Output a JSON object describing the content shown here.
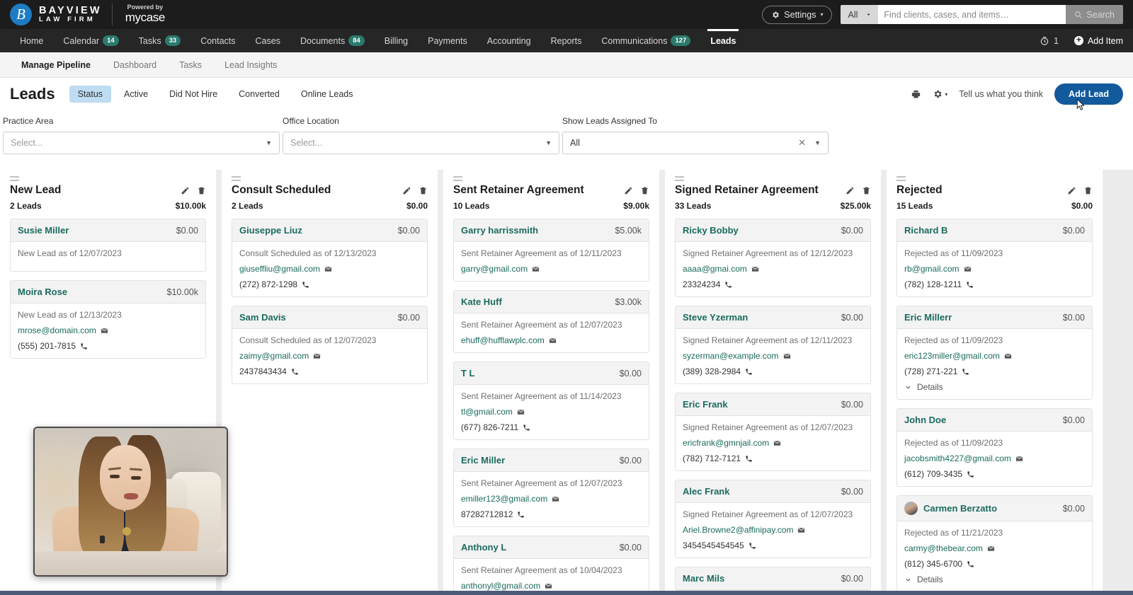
{
  "topbar": {
    "brand_line1": "BAYVIEW",
    "brand_line2": "LAW FIRM",
    "brand_mark": "B",
    "powered_by_top": "Powered by",
    "powered_by_bottom": "mycase",
    "settings_label": "Settings",
    "settings_icon": "gear-icon",
    "search_scope": "All",
    "search_placeholder": "Find clients, cases, and items…",
    "search_value": "",
    "search_button_label": "Search"
  },
  "nav": {
    "items": [
      {
        "label": "Home",
        "badge": "",
        "active": false
      },
      {
        "label": "Calendar",
        "badge": "14",
        "active": false
      },
      {
        "label": "Tasks",
        "badge": "33",
        "active": false
      },
      {
        "label": "Contacts",
        "badge": "",
        "active": false
      },
      {
        "label": "Cases",
        "badge": "",
        "active": false
      },
      {
        "label": "Documents",
        "badge": "84",
        "active": false
      },
      {
        "label": "Billing",
        "badge": "",
        "active": false
      },
      {
        "label": "Payments",
        "badge": "",
        "active": false
      },
      {
        "label": "Accounting",
        "badge": "",
        "active": false
      },
      {
        "label": "Reports",
        "badge": "",
        "active": false
      },
      {
        "label": "Communications",
        "badge": "127",
        "active": false
      },
      {
        "label": "Leads",
        "badge": "",
        "active": true
      }
    ],
    "timer_count": "1",
    "add_item_label": "Add Item"
  },
  "subnav": {
    "items": [
      {
        "label": "Manage Pipeline",
        "active": true
      },
      {
        "label": "Dashboard",
        "active": false
      },
      {
        "label": "Tasks",
        "active": false
      },
      {
        "label": "Lead Insights",
        "active": false
      }
    ]
  },
  "pagehead": {
    "title": "Leads",
    "pills": [
      {
        "label": "Status",
        "active": true
      },
      {
        "label": "Active",
        "active": false
      },
      {
        "label": "Did Not Hire",
        "active": false
      },
      {
        "label": "Converted",
        "active": false
      },
      {
        "label": "Online Leads",
        "active": false
      }
    ],
    "print_icon": "printer-icon",
    "settings_icon": "gear-icon",
    "feedback_label": "Tell us what you think",
    "add_lead_label": "Add Lead",
    "accent_color": "#125a9c"
  },
  "filters": [
    {
      "label": "Practice Area",
      "value": "",
      "placeholder": "Select...",
      "clearable": false
    },
    {
      "label": "Office Location",
      "value": "",
      "placeholder": "Select...",
      "clearable": false
    },
    {
      "label": "Show Leads Assigned To",
      "value": "All",
      "placeholder": "",
      "clearable": true
    }
  ],
  "board": {
    "columns": [
      {
        "title": "New Lead",
        "count": "2 Leads",
        "amount": "$10.00k",
        "cards": [
          {
            "name": "Susie Miller",
            "amount": "$0.00",
            "status": "New Lead as of 12/07/2023",
            "email": "",
            "phone": "",
            "avatar": false,
            "details": false
          },
          {
            "name": "Moira Rose",
            "amount": "$10.00k",
            "status": "New Lead as of 12/13/2023",
            "email": "mrose@domain.com",
            "phone": "(555) 201-7815",
            "avatar": false,
            "details": false
          }
        ]
      },
      {
        "title": "Consult Scheduled",
        "count": "2 Leads",
        "amount": "$0.00",
        "cards": [
          {
            "name": "Giuseppe Liuz",
            "amount": "$0.00",
            "status": "Consult Scheduled as of 12/13/2023",
            "email": "giuseffliu@gmail.com",
            "phone": "(272) 872-1298",
            "avatar": false,
            "details": false
          },
          {
            "name": "Sam Davis",
            "amount": "$0.00",
            "status": "Consult Scheduled as of 12/07/2023",
            "email": "zaimy@gmail.com",
            "phone": "2437843434",
            "avatar": false,
            "details": false
          }
        ]
      },
      {
        "title": "Sent Retainer Agreement",
        "count": "10 Leads",
        "amount": "$9.00k",
        "cards": [
          {
            "name": "Garry harrissmith",
            "amount": "$5.00k",
            "status": "Sent Retainer Agreement as of 12/11/2023",
            "email": "garry@gmail.com",
            "phone": "",
            "avatar": false,
            "details": false
          },
          {
            "name": "Kate Huff",
            "amount": "$3.00k",
            "status": "Sent Retainer Agreement as of 12/07/2023",
            "email": "ehuff@hufflawplc.com",
            "phone": "",
            "avatar": false,
            "details": false
          },
          {
            "name": "T L",
            "amount": "$0.00",
            "status": "Sent Retainer Agreement as of 11/14/2023",
            "email": "tl@gmail.com",
            "phone": "(677) 826-7211",
            "avatar": false,
            "details": false
          },
          {
            "name": "Eric Miller",
            "amount": "$0.00",
            "status": "Sent Retainer Agreement as of 12/07/2023",
            "email": "emiller123@gmail.com",
            "phone": "87282712812",
            "avatar": false,
            "details": false
          },
          {
            "name": "Anthony L",
            "amount": "$0.00",
            "status": "Sent Retainer Agreement as of 10/04/2023",
            "email": "anthonyl@gmail.com",
            "phone": "",
            "avatar": false,
            "details": false
          }
        ]
      },
      {
        "title": "Signed Retainer Agreement",
        "count": "33 Leads",
        "amount": "$25.00k",
        "cards": [
          {
            "name": "Ricky Bobby",
            "amount": "$0.00",
            "status": "Signed Retainer Agreement as of 12/12/2023",
            "email": "aaaa@gmai.com",
            "phone": "23324234",
            "avatar": false,
            "details": false
          },
          {
            "name": "Steve Yzerman",
            "amount": "$0.00",
            "status": "Signed Retainer Agreement as of 12/11/2023",
            "email": "syzerman@example.com",
            "phone": "(389) 328-2984",
            "avatar": false,
            "details": false
          },
          {
            "name": "Eric Frank",
            "amount": "$0.00",
            "status": "Signed Retainer Agreement as of 12/07/2023",
            "email": "ericfrank@gmnjail.com",
            "phone": "(782) 712-7121",
            "avatar": false,
            "details": false
          },
          {
            "name": "Alec Frank",
            "amount": "$0.00",
            "status": "Signed Retainer Agreement as of 12/07/2023",
            "email": "Ariel.Browne2@affinipay.com",
            "phone": "3454545454545",
            "avatar": false,
            "details": false
          },
          {
            "name": "Marc Mils",
            "amount": "$0.00",
            "status": "",
            "email": "",
            "phone": "",
            "avatar": false,
            "details": false
          }
        ]
      },
      {
        "title": "Rejected",
        "count": "15 Leads",
        "amount": "$0.00",
        "cards": [
          {
            "name": "Richard B",
            "amount": "$0.00",
            "status": "Rejected as of 11/09/2023",
            "email": "rb@gmail.com",
            "phone": "(782) 128-1211",
            "avatar": false,
            "details": false
          },
          {
            "name": "Eric Millerr",
            "amount": "$0.00",
            "status": "Rejected as of 11/09/2023",
            "email": "eric123miller@gmail.com",
            "phone": "(728) 271-221",
            "avatar": false,
            "details": true
          },
          {
            "name": "John Doe",
            "amount": "$0.00",
            "status": "Rejected as of 11/09/2023",
            "email": "jacobsmith4227@gmail.com",
            "phone": "(612) 709-3435",
            "avatar": false,
            "details": false
          },
          {
            "name": "Carmen Berzatto",
            "amount": "$0.00",
            "status": "Rejected as of 11/21/2023",
            "email": "carmy@thebear.com",
            "phone": "(812) 345-6700",
            "avatar": true,
            "details": true
          }
        ]
      }
    ],
    "details_label": "Details",
    "edit_icon": "pencil-icon",
    "delete_icon": "trash-icon",
    "grip_icon": "drag-handle-icon",
    "email_icon": "envelope-icon",
    "phone_icon": "phone-icon"
  },
  "video_overlay": {
    "name": "presenter-video-pip"
  }
}
